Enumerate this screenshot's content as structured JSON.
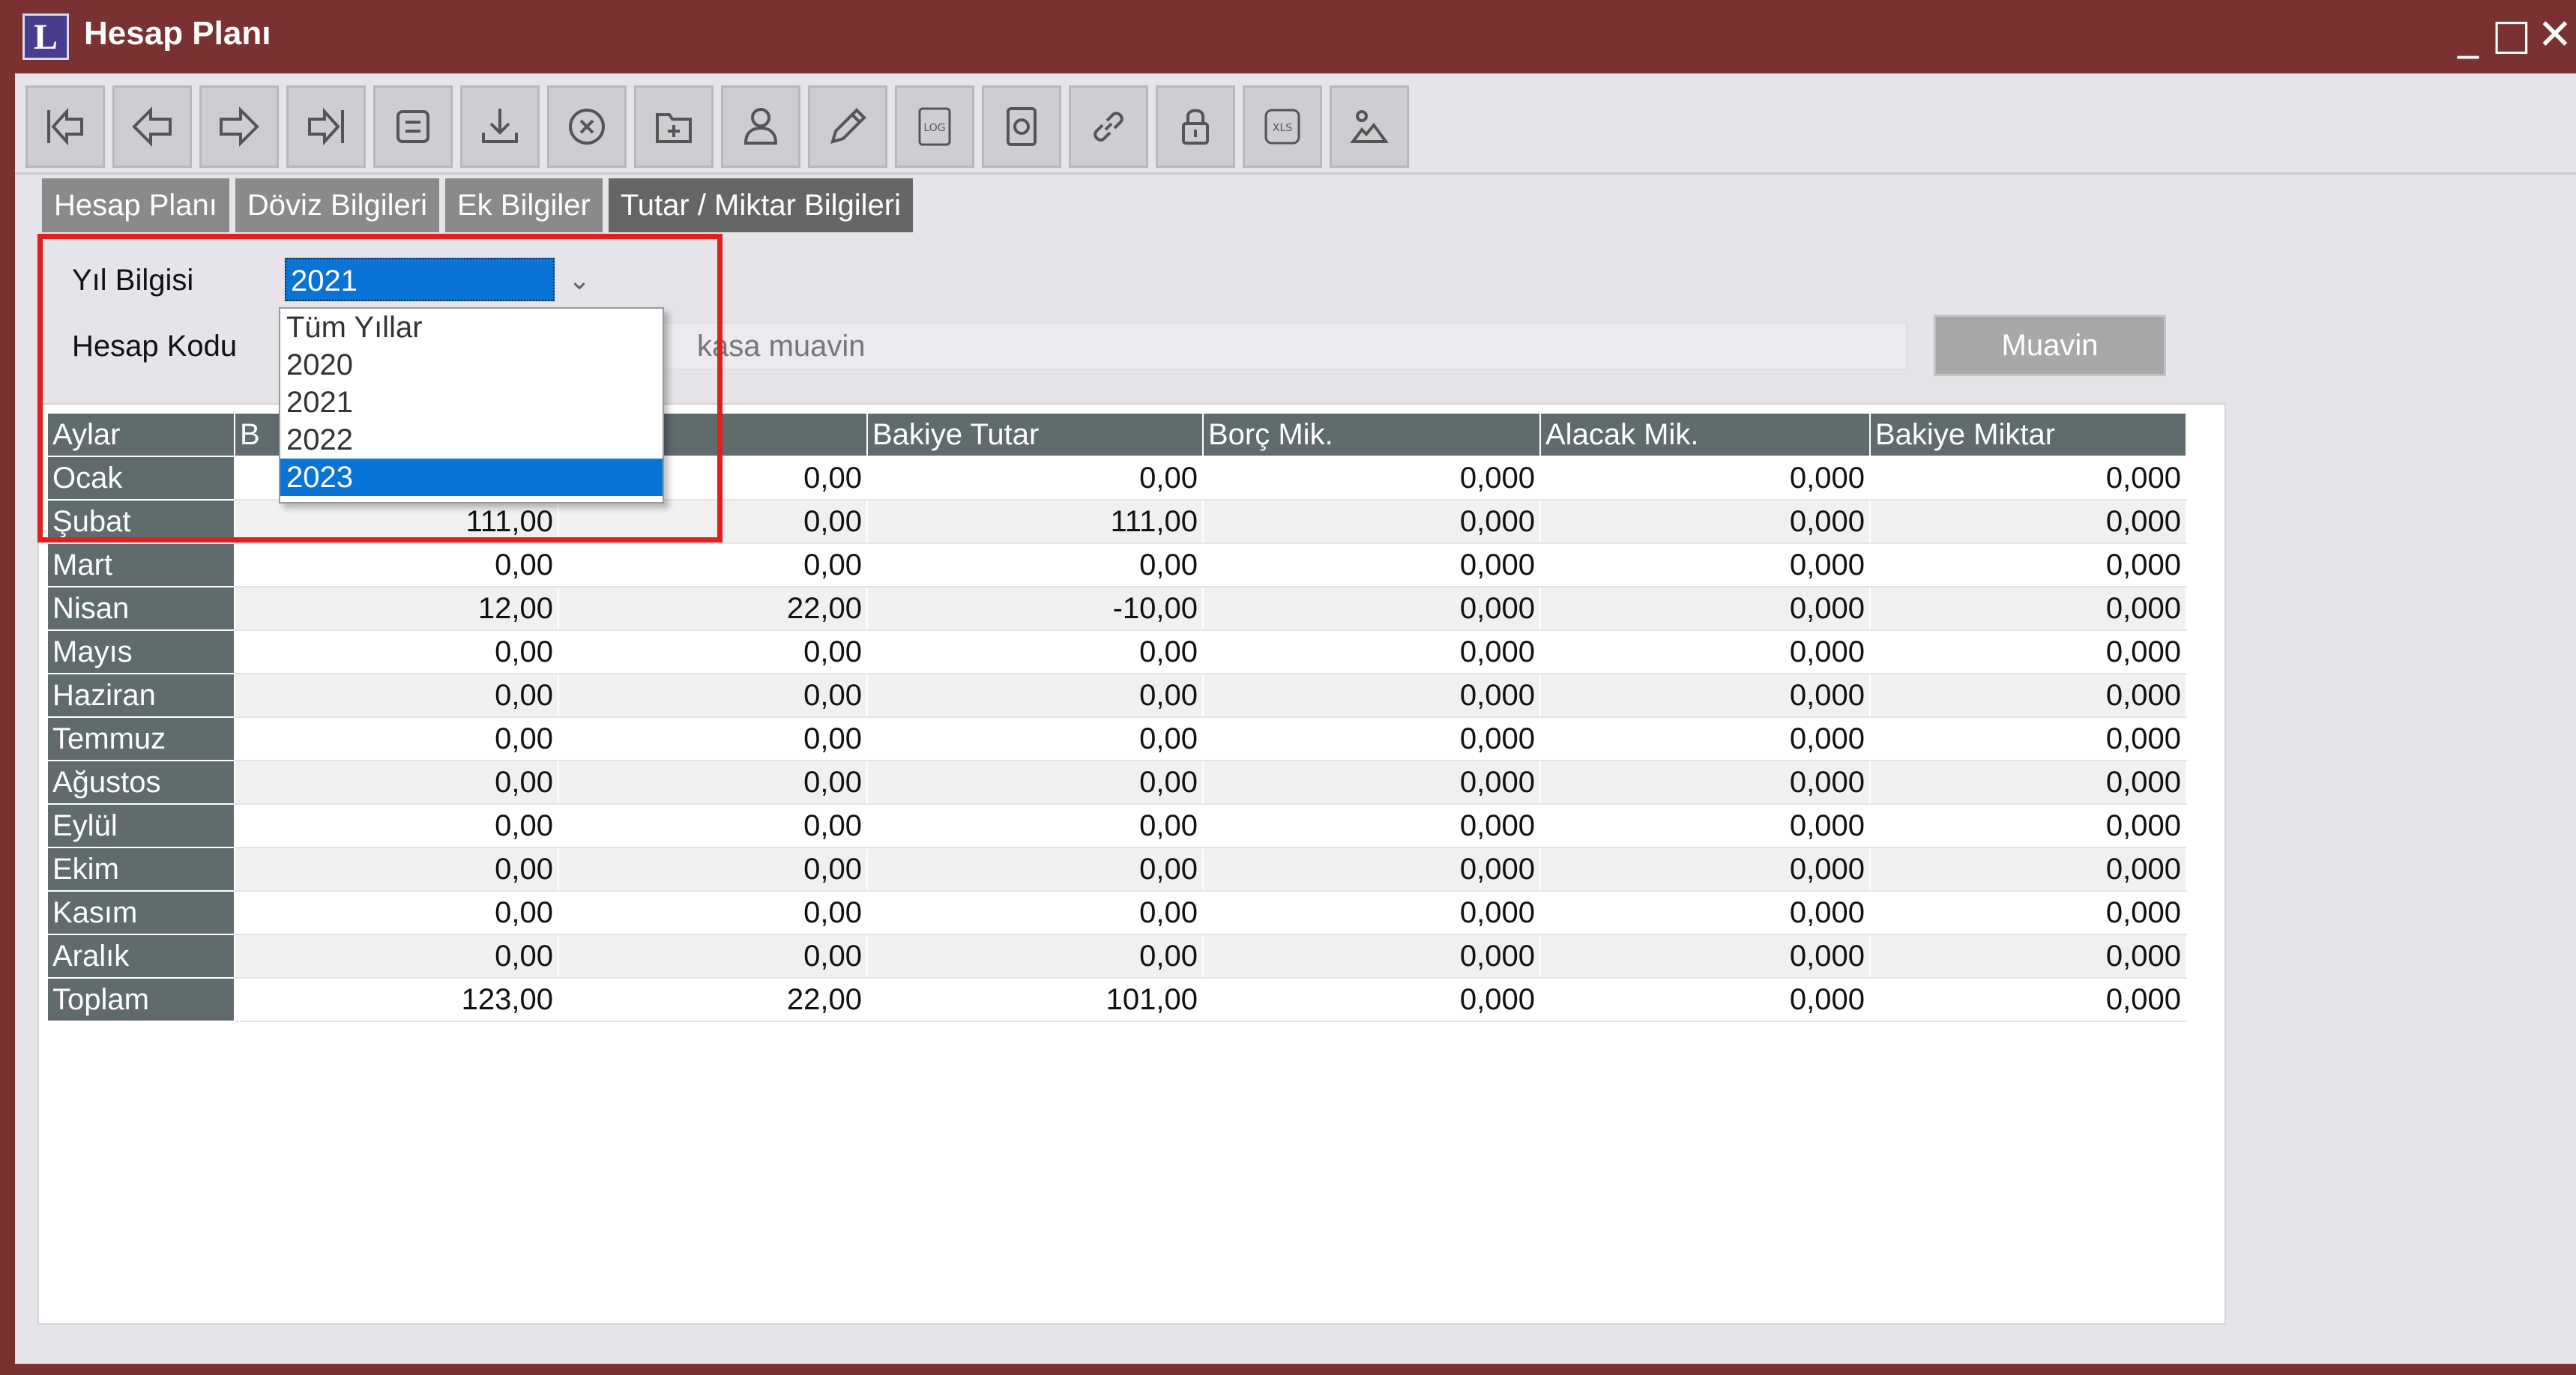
{
  "window": {
    "title": "Hesap Planı",
    "logo_letter": "L",
    "controls": {
      "minimize": "_",
      "maximize": "□",
      "close": "✕"
    }
  },
  "toolbar": {
    "buttons": [
      "first-record-icon",
      "previous-record-icon",
      "next-record-icon",
      "last-record-icon",
      "form-icon",
      "download-icon",
      "cancel-icon",
      "add-icon",
      "user-icon",
      "edit-icon",
      "log-icon",
      "document-icon",
      "link-icon",
      "lock-icon",
      "xls-icon",
      "preview-icon"
    ],
    "log_label": "LOG",
    "xls_label": "XLS"
  },
  "tabs": [
    {
      "label": "Hesap Planı",
      "active": false
    },
    {
      "label": "Döviz Bilgileri",
      "active": false
    },
    {
      "label": "Ek Bilgiler",
      "active": false
    },
    {
      "label": "Tutar / Miktar Bilgileri",
      "active": true
    }
  ],
  "form": {
    "year_label": "Yıl Bilgisi",
    "year_value": "2021",
    "code_label": "Hesap Kodu",
    "code_description": "kasa muavin",
    "muavin_button": "Muavin"
  },
  "dropdown": {
    "options": [
      "Tüm Yıllar",
      "2020",
      "2021",
      "2022",
      "2023"
    ],
    "highlighted": "2023"
  },
  "grid": {
    "columns": [
      "Aylar",
      "B",
      "ak Tut.",
      "Bakiye Tutar",
      "Borç Mik.",
      "Alacak Mik.",
      "Bakiye Miktar"
    ],
    "rows": [
      [
        "Ocak",
        "",
        "0,00",
        "0,00",
        "0,000",
        "0,000",
        "0,000"
      ],
      [
        "Şubat",
        "111,00",
        "0,00",
        "111,00",
        "0,000",
        "0,000",
        "0,000"
      ],
      [
        "Mart",
        "0,00",
        "0,00",
        "0,00",
        "0,000",
        "0,000",
        "0,000"
      ],
      [
        "Nisan",
        "12,00",
        "22,00",
        "-10,00",
        "0,000",
        "0,000",
        "0,000"
      ],
      [
        "Mayıs",
        "0,00",
        "0,00",
        "0,00",
        "0,000",
        "0,000",
        "0,000"
      ],
      [
        "Haziran",
        "0,00",
        "0,00",
        "0,00",
        "0,000",
        "0,000",
        "0,000"
      ],
      [
        "Temmuz",
        "0,00",
        "0,00",
        "0,00",
        "0,000",
        "0,000",
        "0,000"
      ],
      [
        "Ağustos",
        "0,00",
        "0,00",
        "0,00",
        "0,000",
        "0,000",
        "0,000"
      ],
      [
        "Eylül",
        "0,00",
        "0,00",
        "0,00",
        "0,000",
        "0,000",
        "0,000"
      ],
      [
        "Ekim",
        "0,00",
        "0,00",
        "0,00",
        "0,000",
        "0,000",
        "0,000"
      ],
      [
        "Kasım",
        "0,00",
        "0,00",
        "0,00",
        "0,000",
        "0,000",
        "0,000"
      ],
      [
        "Aralık",
        "0,00",
        "0,00",
        "0,00",
        "0,000",
        "0,000",
        "0,000"
      ],
      [
        "Toplam",
        "123,00",
        "22,00",
        "101,00",
        "0,000",
        "0,000",
        "0,000"
      ]
    ]
  },
  "colors": {
    "title_bar": "#7a3131",
    "selection": "#0a74d6",
    "grid_header": "#5f6b6d",
    "highlight_box": "#e02020"
  }
}
